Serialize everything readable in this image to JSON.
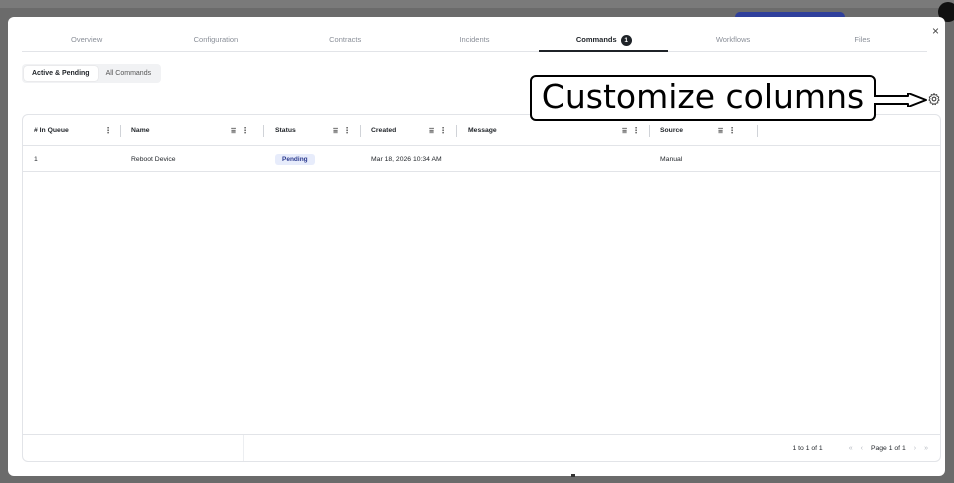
{
  "app": {
    "close_glyph": "×"
  },
  "tabs": [
    {
      "label": "Overview",
      "active": false
    },
    {
      "label": "Configuration",
      "active": false
    },
    {
      "label": "Contracts",
      "active": false
    },
    {
      "label": "Incidents",
      "active": false
    },
    {
      "label": "Commands",
      "active": true,
      "badge": "1"
    },
    {
      "label": "Workflows",
      "active": false
    },
    {
      "label": "Files",
      "active": false
    }
  ],
  "subtabs": [
    {
      "label": "Active & Pending",
      "active": true
    },
    {
      "label": "All Commands",
      "active": false
    }
  ],
  "callout": {
    "text": "Customize columns"
  },
  "grid": {
    "columns": [
      {
        "label": "# In Queue"
      },
      {
        "label": "Name"
      },
      {
        "label": "Status"
      },
      {
        "label": "Created"
      },
      {
        "label": "Message"
      },
      {
        "label": "Source"
      }
    ],
    "rows": [
      {
        "queue": "1",
        "name": "Reboot Device",
        "status": "Pending",
        "created": "Mar 18, 2026 10:34 AM",
        "message": "",
        "source": "Manual"
      }
    ],
    "footer": {
      "range": "1 to 1 of 1",
      "page": "Page 1 of 1"
    }
  },
  "icons": {
    "filter": "filter-icon",
    "menu": "kebab-menu-icon",
    "settings": "gear-icon",
    "first": "first-page-icon",
    "prev": "prev-page-icon",
    "next": "next-page-icon",
    "last": "last-page-icon"
  },
  "colors": {
    "accent": "#1f2328",
    "status_pending_bg": "#e7ecfb",
    "status_pending_text": "#2b3a8f",
    "backdrop": "#6b6b6b"
  }
}
